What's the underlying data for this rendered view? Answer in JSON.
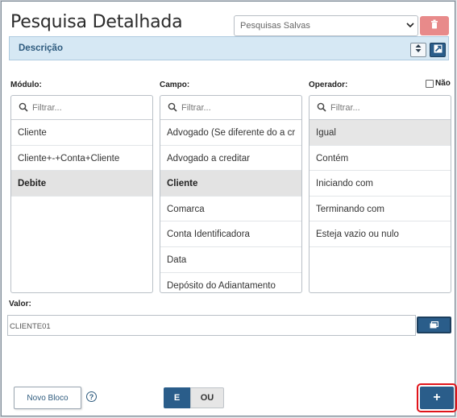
{
  "header": {
    "title": "Pesquisa Detalhada",
    "saved_searches_value": "Pesquisas Salvas"
  },
  "description": {
    "label": "Descrição"
  },
  "columns": {
    "modulo": {
      "label": "Módulo:",
      "filter_placeholder": "Filtrar...",
      "items": [
        "Cliente",
        "Cliente+-+Conta+Cliente",
        "Debite"
      ],
      "selected": "Debite"
    },
    "campo": {
      "label": "Campo:",
      "filter_placeholder": "Filtrar...",
      "items": [
        "Advogado (Se diferente do a cr",
        "Advogado a creditar",
        "Cliente",
        "Comarca",
        "Conta Identificadora",
        "Data",
        "Depósito do Adiantamento"
      ],
      "selected": "Cliente"
    },
    "operador": {
      "label": "Operador:",
      "filter_placeholder": "Filtrar...",
      "items": [
        "Igual",
        "Contém",
        "Iniciando com",
        "Terminando com",
        "Esteja vazio ou nulo"
      ],
      "selected": "Igual"
    }
  },
  "nao_checkbox": {
    "label": "Não",
    "checked": false
  },
  "valor": {
    "label": "Valor:",
    "value": "CLIENTE01"
  },
  "footer": {
    "novo_bloco_label": "Novo Bloco",
    "help_label": "?",
    "e_label": "E",
    "ou_label": "OU",
    "add_label": "+"
  },
  "colors": {
    "primary": "#2a5d8a",
    "danger": "#e88a8a",
    "description_bg": "#d6e8f4",
    "highlight_border": "#e0141a"
  }
}
